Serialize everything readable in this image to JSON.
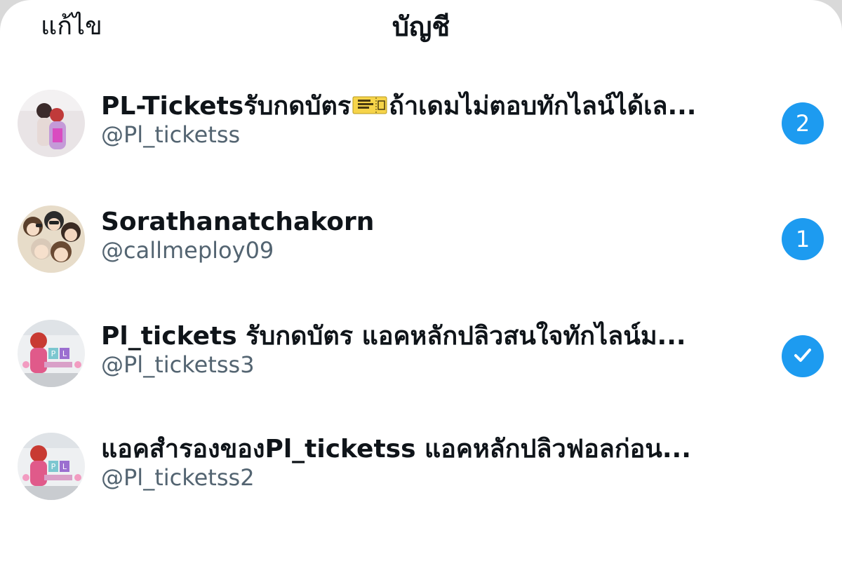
{
  "header": {
    "edit_label": "แก้ไข",
    "title": "บัญชี"
  },
  "accounts": [
    {
      "name": "PL-Ticketsรับกดบัตร",
      "name_suffix": "ถ้าเดมไม่ตอบทักไลน์ได้เล...",
      "emoji": "ticket-emoji",
      "handle": "@Pl_ticketss",
      "badge": "2",
      "avatar": "couple-photo-avatar"
    },
    {
      "name": "Sorathanatchakorn",
      "handle": "@callmeploy09",
      "badge": "1",
      "avatar": "cartoon-group-avatar"
    },
    {
      "name": "Pl_tickets รับกดบัตร แอคหลักปลิวสนใจทักไลน์ม...",
      "handle": "@Pl_ticketss3",
      "badge_icon": "checkmark-icon",
      "selected": true,
      "avatar": "pl-logo-avatar"
    },
    {
      "name": "แอคสำรองของPl_ticketss แอคหลักปลิวฟอลก่อน...",
      "handle": "@Pl_ticketss2",
      "avatar": "pl-logo-avatar"
    }
  ],
  "colors": {
    "badge": "#1d9bf0",
    "handle": "#536471",
    "text": "#0f1419"
  }
}
